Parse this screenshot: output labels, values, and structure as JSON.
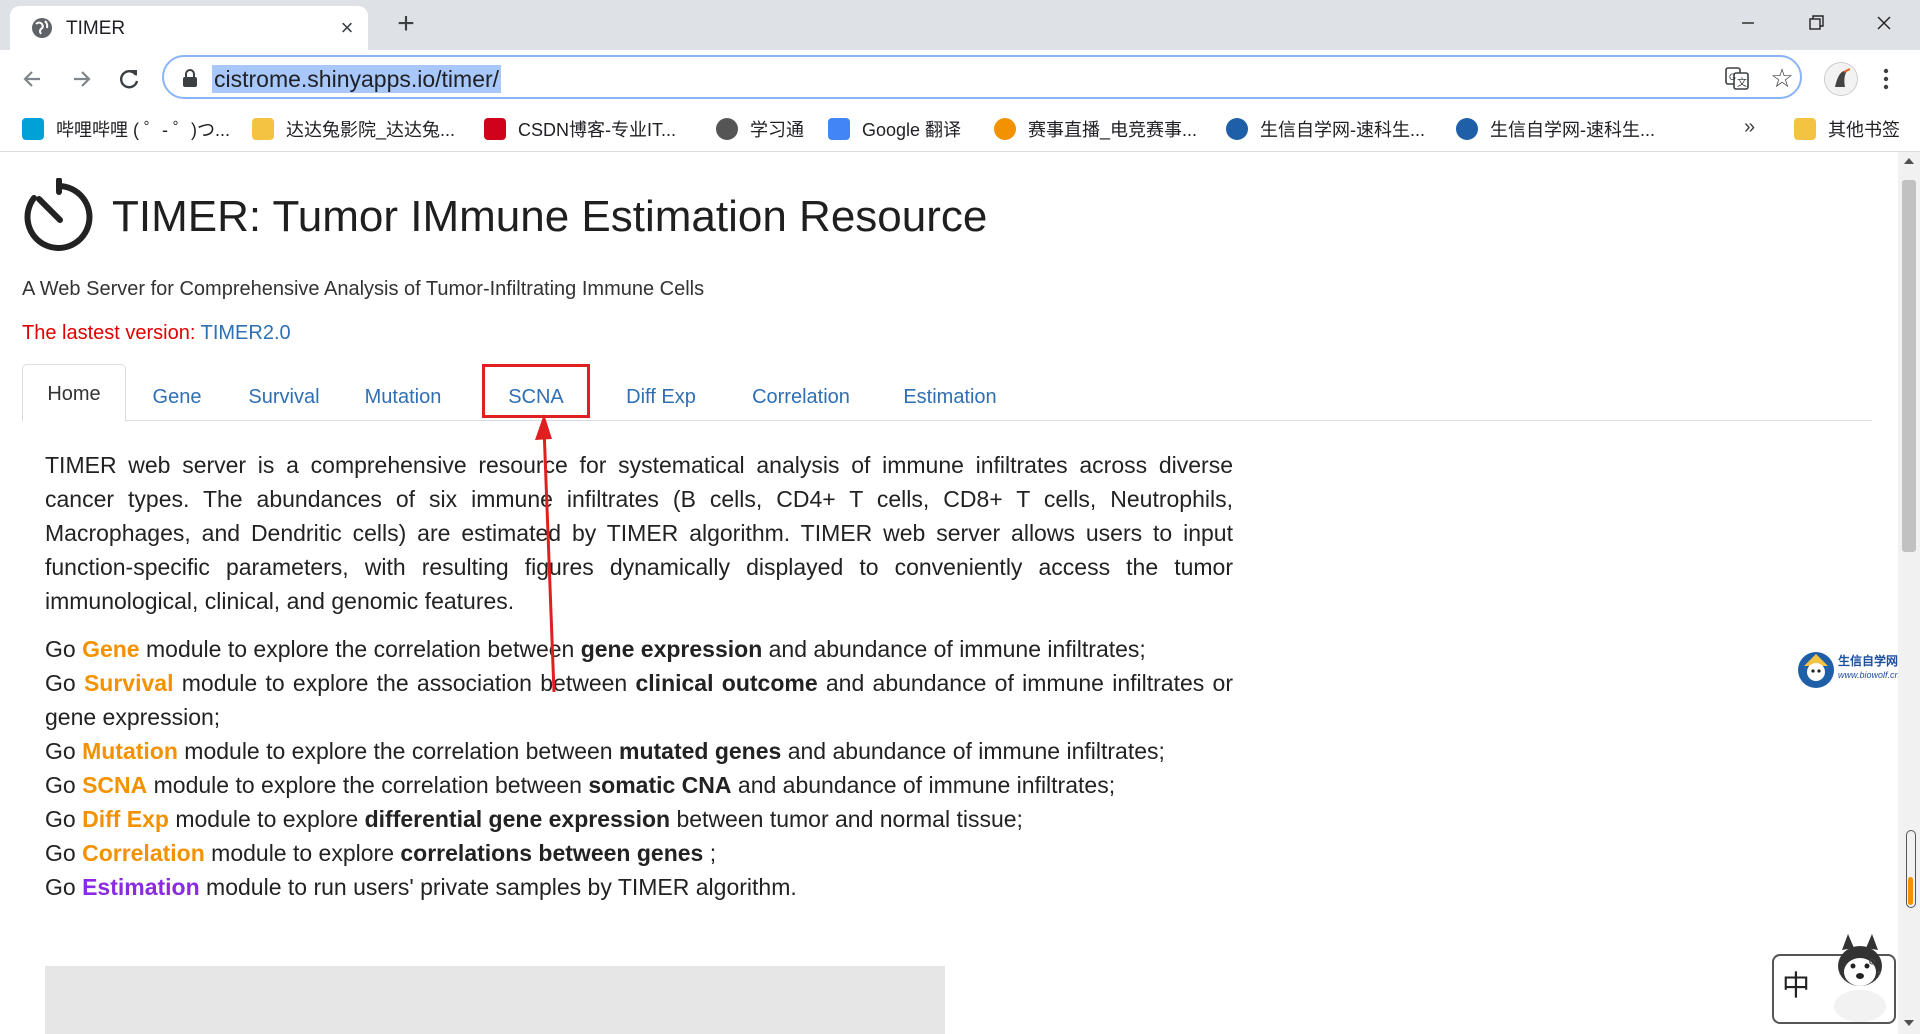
{
  "browser": {
    "tab_title": "TIMER",
    "url": "cistrome.shinyapps.io/timer/",
    "bookmarks": [
      {
        "label": "哔哩哔哩 ( ゜- ゜)つ...",
        "color": "#00a1d6"
      },
      {
        "label": "达达兔影院_达达兔...",
        "color": "#f5c342"
      },
      {
        "label": "CSDN博客-专业IT...",
        "color": "#d0021b"
      },
      {
        "label": "学习通",
        "color": "#555555"
      },
      {
        "label": "Google 翻译",
        "color": "#4285f4"
      },
      {
        "label": "赛事直播_电竞赛事...",
        "color": "#f39200"
      },
      {
        "label": "生信自学网-速科生...",
        "color": "#1e5fa8"
      },
      {
        "label": "生信自学网-速科生...",
        "color": "#1e5fa8"
      }
    ],
    "bookmarks_more": "»",
    "other_bookmarks": "其他书签"
  },
  "page": {
    "title": "TIMER: Tumor IMmune Estimation Resource",
    "subtitle": "A Web Server for Comprehensive Analysis of Tumor-Infiltrating Immune Cells",
    "version_label": "The lastest version: ",
    "version_link": "TIMER2.0",
    "tabs": [
      "Home",
      "Gene",
      "Survival",
      "Mutation",
      "SCNA",
      "Diff Exp",
      "Correlation",
      "Estimation"
    ],
    "active_tab": "Home",
    "highlighted_tab": "SCNA",
    "intro": "TIMER web server is a comprehensive resource for systematical analysis of immune infiltrates across diverse cancer types. The abundances of six immune infiltrates (B cells, CD4+ T cells, CD8+ T cells, Neutrophils, Macrophages, and Dendritic cells) are estimated by TIMER algorithm. TIMER web server allows users to input function-specific parameters, with resulting figures dynamically displayed to conveniently access the tumor immunological, clinical, and genomic features.",
    "modules": [
      {
        "go": "Go ",
        "name": "Gene",
        "mid": " module to explore the correlation between ",
        "bold": "gene expression",
        "tail": " and abundance of immune infiltrates;"
      },
      {
        "go": "Go ",
        "name": "Survival",
        "mid": " module to explore the association between ",
        "bold": "clinical outcome",
        "tail": " and abundance of immune infiltrates or gene expression;"
      },
      {
        "go": "Go ",
        "name": "Mutation",
        "mid": " module to explore the correlation between ",
        "bold": "mutated genes",
        "tail": " and abundance of immune infiltrates;"
      },
      {
        "go": "Go ",
        "name": "SCNA",
        "mid": " module to explore the correlation between ",
        "bold": "somatic CNA",
        "tail": " and abundance of immune infiltrates;"
      },
      {
        "go": "Go ",
        "name": "Diff Exp",
        "mid": " module to explore ",
        "bold": "differential gene expression",
        "tail": " between tumor and normal tissue;"
      },
      {
        "go": "Go ",
        "name": "Correlation",
        "mid": " module to explore ",
        "bold": "correlations between genes",
        "tail": " ;"
      },
      {
        "go": "Go ",
        "name": "Estimation",
        "mid": " module to run users' private samples by TIMER algorithm.",
        "bold": "",
        "tail": ""
      }
    ]
  },
  "overlays": {
    "watermark_text": "生信自学网",
    "watermark_url": "www.biowolf.cn",
    "ime_char": "中",
    "ime_mark": "°,"
  },
  "colors": {
    "link": "#2f6fb3",
    "module_orange": "#f39200",
    "module_purple": "#8a2be2",
    "version_red": "#e00000",
    "highlight_red": "#e02020"
  }
}
